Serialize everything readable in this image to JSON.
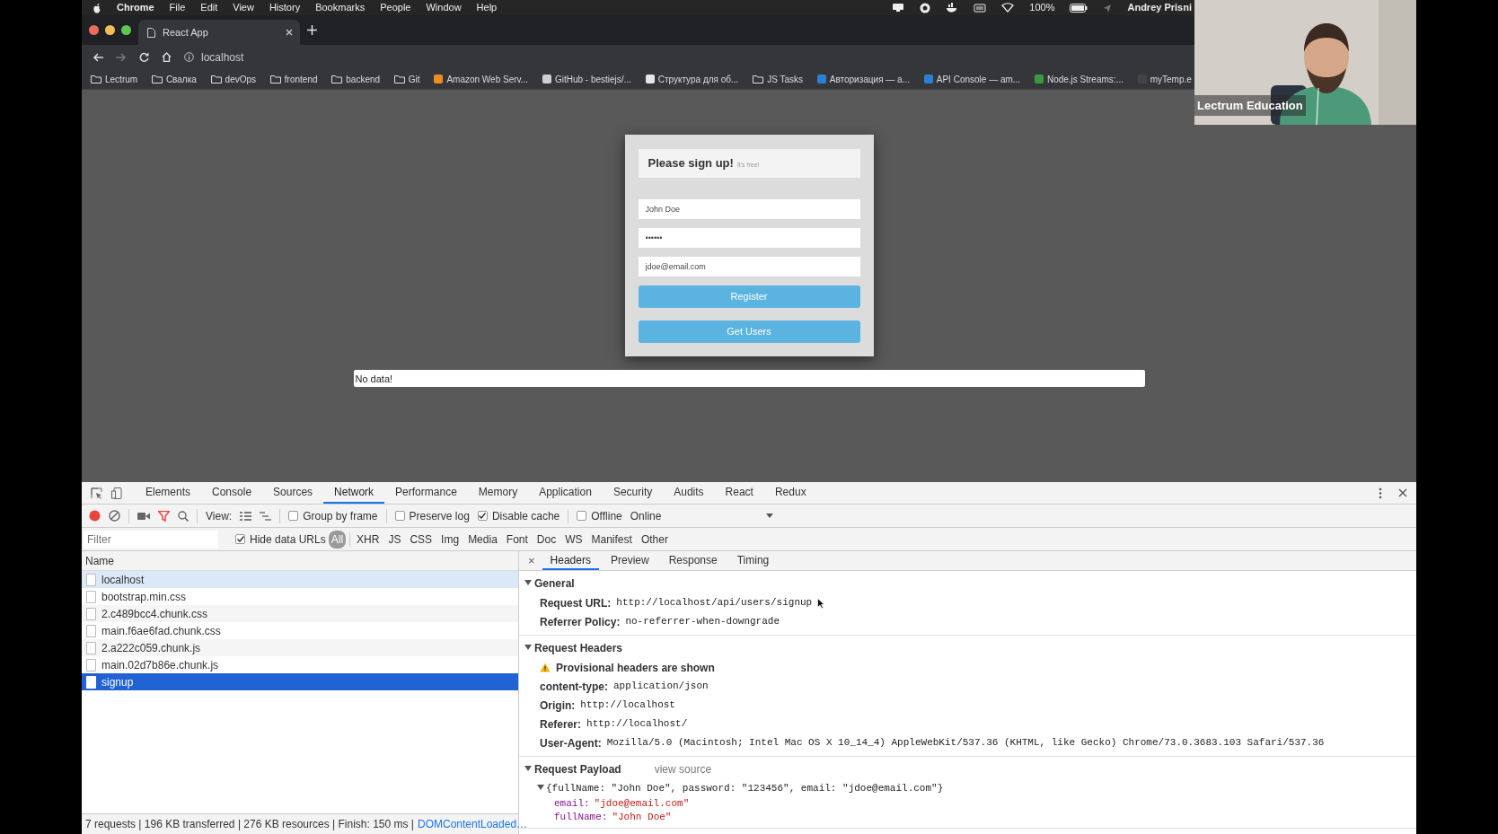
{
  "menu_bar": {
    "app": "Chrome",
    "items": [
      "File",
      "Edit",
      "View",
      "History",
      "Bookmarks",
      "People",
      "Window",
      "Help"
    ],
    "battery": "100%",
    "user": "Andrey Prisni"
  },
  "browser": {
    "tabs": [
      {
        "title": "React App",
        "selected": true
      }
    ],
    "address": "localhost",
    "bookmarks": [
      {
        "label": "Lectrum",
        "kind": "folder"
      },
      {
        "label": "Свалка",
        "kind": "folder"
      },
      {
        "label": "devOps",
        "kind": "folder"
      },
      {
        "label": "frontend",
        "kind": "folder"
      },
      {
        "label": "backend",
        "kind": "folder"
      },
      {
        "label": "Git",
        "kind": "folder"
      },
      {
        "label": "Amazon Web Serv...",
        "kind": "site",
        "color": "#f08a24"
      },
      {
        "label": "GitHub - bestiejs/...",
        "kind": "site",
        "color": "#d0d0d0"
      },
      {
        "label": "Структура для об...",
        "kind": "site",
        "color": "#e6e6e6"
      },
      {
        "label": "JS Tasks",
        "kind": "folder"
      },
      {
        "label": "Авторизация — а...",
        "kind": "site",
        "color": "#2d7fd3"
      },
      {
        "label": "API Console — am...",
        "kind": "site",
        "color": "#2d7fd3"
      },
      {
        "label": "Node.js Streams:...",
        "kind": "site",
        "color": "#3c9a3c"
      },
      {
        "label": "myTemp.e",
        "kind": "site",
        "color": "#444444"
      }
    ]
  },
  "page": {
    "form": {
      "title": "Please sign up!",
      "subtitle": "It's free!",
      "fields": [
        {
          "value": "John Doe"
        },
        {
          "value": "••••••"
        },
        {
          "value": "jdoe@email.com"
        }
      ],
      "buttons": [
        "Register",
        "Get Users"
      ]
    },
    "result": "No data!"
  },
  "devtools": {
    "tabs": [
      {
        "label": "Elements",
        "selected": false
      },
      {
        "label": "Console",
        "selected": false
      },
      {
        "label": "Sources",
        "selected": false
      },
      {
        "label": "Network",
        "selected": true
      },
      {
        "label": "Performance",
        "selected": false
      },
      {
        "label": "Memory",
        "selected": false
      },
      {
        "label": "Application",
        "selected": false
      },
      {
        "label": "Security",
        "selected": false
      },
      {
        "label": "Audits",
        "selected": false
      },
      {
        "label": "React",
        "selected": false
      },
      {
        "label": "Redux",
        "selected": false
      }
    ],
    "toolbar": {
      "recording": true,
      "filter_active": true,
      "view_label": "View:",
      "options": [
        {
          "label": "Group by frame",
          "checked": false
        },
        {
          "label": "Preserve log",
          "checked": false
        },
        {
          "label": "Disable cache",
          "checked": true
        },
        {
          "label": "Offline",
          "checked": false
        }
      ],
      "throttling": "Online"
    },
    "filter_bar": {
      "placeholder": "Filter",
      "hide_data_urls": {
        "label": "Hide data URLs",
        "checked": true
      },
      "types": [
        {
          "label": "All",
          "selected": true
        },
        {
          "label": "XHR",
          "selected": false
        },
        {
          "label": "JS",
          "selected": false
        },
        {
          "label": "CSS",
          "selected": false
        },
        {
          "label": "Img",
          "selected": false
        },
        {
          "label": "Media",
          "selected": false
        },
        {
          "label": "Font",
          "selected": false
        },
        {
          "label": "Doc",
          "selected": false
        },
        {
          "label": "WS",
          "selected": false
        },
        {
          "label": "Manifest",
          "selected": false
        },
        {
          "label": "Other",
          "selected": false
        }
      ]
    },
    "requests": {
      "column": "Name",
      "rows": [
        {
          "name": "localhost",
          "selected": false,
          "hovered": true
        },
        {
          "name": "bootstrap.min.css",
          "selected": false,
          "hovered": false
        },
        {
          "name": "2.c489bcc4.chunk.css",
          "selected": false,
          "hovered": false
        },
        {
          "name": "main.f6ae6fad.chunk.css",
          "selected": false,
          "hovered": false
        },
        {
          "name": "2.a222c059.chunk.js",
          "selected": false,
          "hovered": false
        },
        {
          "name": "main.02d7b86e.chunk.js",
          "selected": false,
          "hovered": false
        },
        {
          "name": "signup",
          "selected": true,
          "hovered": false
        }
      ],
      "status": "7 requests | 196 KB transferred | 276 KB resources | Finish: 150 ms |",
      "status_link": "DOMContentLoaded…"
    },
    "detail": {
      "close": "×",
      "tabs": [
        {
          "label": "Headers",
          "selected": true
        },
        {
          "label": "Preview",
          "selected": false
        },
        {
          "label": "Response",
          "selected": false
        },
        {
          "label": "Timing",
          "selected": false
        }
      ],
      "sections": [
        {
          "title": "General",
          "expanded": true,
          "rows": [
            {
              "kind": "pair",
              "key": "Request URL:",
              "value": "http://localhost/api/users/signup"
            },
            {
              "kind": "pair",
              "key": "Referrer Policy:",
              "value": "no-referrer-when-downgrade"
            }
          ]
        },
        {
          "title": "Request Headers",
          "expanded": true,
          "rows": [
            {
              "kind": "warning",
              "text": "Provisional headers are shown"
            },
            {
              "kind": "pair",
              "key": "content-type:",
              "value": "application/json"
            },
            {
              "kind": "pair",
              "key": "Origin:",
              "value": "http://localhost"
            },
            {
              "kind": "pair",
              "key": "Referer:",
              "value": "http://localhost/"
            },
            {
              "kind": "pair",
              "key": "User-Agent:",
              "value": "Mozilla/5.0 (Macintosh; Intel Mac OS X 10_14_4) AppleWebKit/537.36 (KHTML, like Gecko) Chrome/73.0.3683.103 Safari/537.36"
            }
          ]
        },
        {
          "title": "Request Payload",
          "expanded": true,
          "link": "view source",
          "rows": [
            {
              "kind": "tree",
              "text": "{fullName: \"John Doe\", password: \"123456\", email: \"jdoe@email.com\"}",
              "expanded": true,
              "children": [
                {
                  "key": "email:",
                  "value": "\"jdoe@email.com\""
                },
                {
                  "key": "fullName:",
                  "value": "\"John Doe\""
                }
              ]
            }
          ]
        }
      ]
    }
  },
  "video_overlay": {
    "caption": "Lectrum Education"
  }
}
